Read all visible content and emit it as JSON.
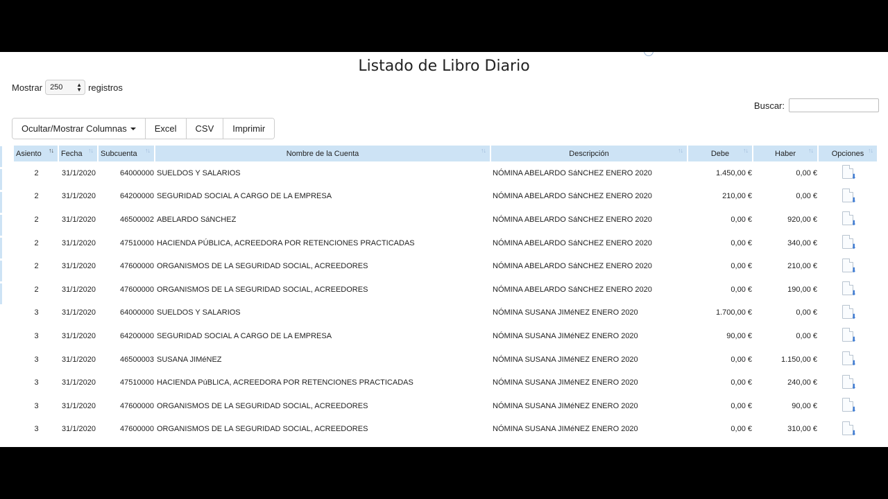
{
  "page": {
    "title": "Listado de Libro Diario"
  },
  "length_menu": {
    "label_before": "Mostrar",
    "value": "250",
    "label_after": "registros"
  },
  "search": {
    "label": "Buscar:",
    "value": ""
  },
  "toolbar": {
    "columns_label": "Ocultar/Mostrar Columnas",
    "excel_label": "Excel",
    "csv_label": "CSV",
    "print_label": "Imprimir"
  },
  "icons": {
    "sort": "sort-arrows-icon",
    "row_action": "document-download-icon"
  },
  "colors": {
    "header_bg": "#cde3f5",
    "link": "#2a6fc9",
    "accent_icon": "#3d7bd4"
  },
  "table": {
    "headers": [
      "Asiento",
      "Fecha",
      "Subcuenta",
      "Nombre de la Cuenta",
      "Descripción",
      "Debe",
      "Haber",
      "Opciones"
    ],
    "rows": [
      {
        "asiento": "2",
        "fecha": "31/1/2020",
        "subcuenta": "64000000",
        "nombre": "SUELDOS Y SALARIOS",
        "descripcion": "NÓMINA ABELARDO SáNCHEZ ENERO 2020",
        "debe": "1.450,00 €",
        "haber": "0,00 €"
      },
      {
        "asiento": "2",
        "fecha": "31/1/2020",
        "subcuenta": "64200000",
        "nombre": "SEGURIDAD SOCIAL A CARGO DE LA EMPRESA",
        "descripcion": "NÓMINA ABELARDO SáNCHEZ ENERO 2020",
        "debe": "210,00 €",
        "haber": "0,00 €"
      },
      {
        "asiento": "2",
        "fecha": "31/1/2020",
        "subcuenta": "46500002",
        "nombre": "ABELARDO SáNCHEZ",
        "descripcion": "NÓMINA ABELARDO SáNCHEZ ENERO 2020",
        "debe": "0,00 €",
        "haber": "920,00 €"
      },
      {
        "asiento": "2",
        "fecha": "31/1/2020",
        "subcuenta": "47510000",
        "nombre": "HACIENDA PÚBLICA, ACREEDORA POR RETENCIONES PRACTICADAS",
        "descripcion": "NÓMINA ABELARDO SáNCHEZ ENERO 2020",
        "debe": "0,00 €",
        "haber": "340,00 €"
      },
      {
        "asiento": "2",
        "fecha": "31/1/2020",
        "subcuenta": "47600000",
        "nombre": "ORGANISMOS DE LA SEGURIDAD SOCIAL, ACREEDORES",
        "descripcion": "NÓMINA ABELARDO SáNCHEZ ENERO 2020",
        "debe": "0,00 €",
        "haber": "210,00 €"
      },
      {
        "asiento": "2",
        "fecha": "31/1/2020",
        "subcuenta": "47600000",
        "nombre": "ORGANISMOS DE LA SEGURIDAD SOCIAL, ACREEDORES",
        "descripcion": "NÓMINA ABELARDO SáNCHEZ ENERO 2020",
        "debe": "0,00 €",
        "haber": "190,00 €"
      },
      {
        "asiento": "3",
        "fecha": "31/1/2020",
        "subcuenta": "64000000",
        "nombre": "SUELDOS Y SALARIOS",
        "descripcion": "NÓMINA SUSANA JIMéNEZ ENERO 2020",
        "debe": "1.700,00 €",
        "haber": "0,00 €"
      },
      {
        "asiento": "3",
        "fecha": "31/1/2020",
        "subcuenta": "64200000",
        "nombre": "SEGURIDAD SOCIAL A CARGO DE LA EMPRESA",
        "descripcion": "NÓMINA SUSANA JIMéNEZ ENERO 2020",
        "debe": "90,00 €",
        "haber": "0,00 €"
      },
      {
        "asiento": "3",
        "fecha": "31/1/2020",
        "subcuenta": "46500003",
        "nombre": "SUSANA JIMéNEZ",
        "descripcion": "NÓMINA SUSANA JIMéNEZ ENERO 2020",
        "debe": "0,00 €",
        "haber": "1.150,00 €"
      },
      {
        "asiento": "3",
        "fecha": "31/1/2020",
        "subcuenta": "47510000",
        "nombre": "HACIENDA PúBLICA, ACREEDORA POR RETENCIONES PRACTICADAS",
        "descripcion": "NÓMINA SUSANA JIMéNEZ ENERO 2020",
        "debe": "0,00 €",
        "haber": "240,00 €"
      },
      {
        "asiento": "3",
        "fecha": "31/1/2020",
        "subcuenta": "47600000",
        "nombre": "ORGANISMOS DE LA SEGURIDAD SOCIAL, ACREEDORES",
        "descripcion": "NÓMINA SUSANA JIMéNEZ ENERO 2020",
        "debe": "0,00 €",
        "haber": "90,00 €"
      },
      {
        "asiento": "3",
        "fecha": "31/1/2020",
        "subcuenta": "47600000",
        "nombre": "ORGANISMOS DE LA SEGURIDAD SOCIAL, ACREEDORES",
        "descripcion": "NÓMINA SUSANA JIMéNEZ ENERO 2020",
        "debe": "0,00 €",
        "haber": "310,00 €"
      }
    ]
  }
}
